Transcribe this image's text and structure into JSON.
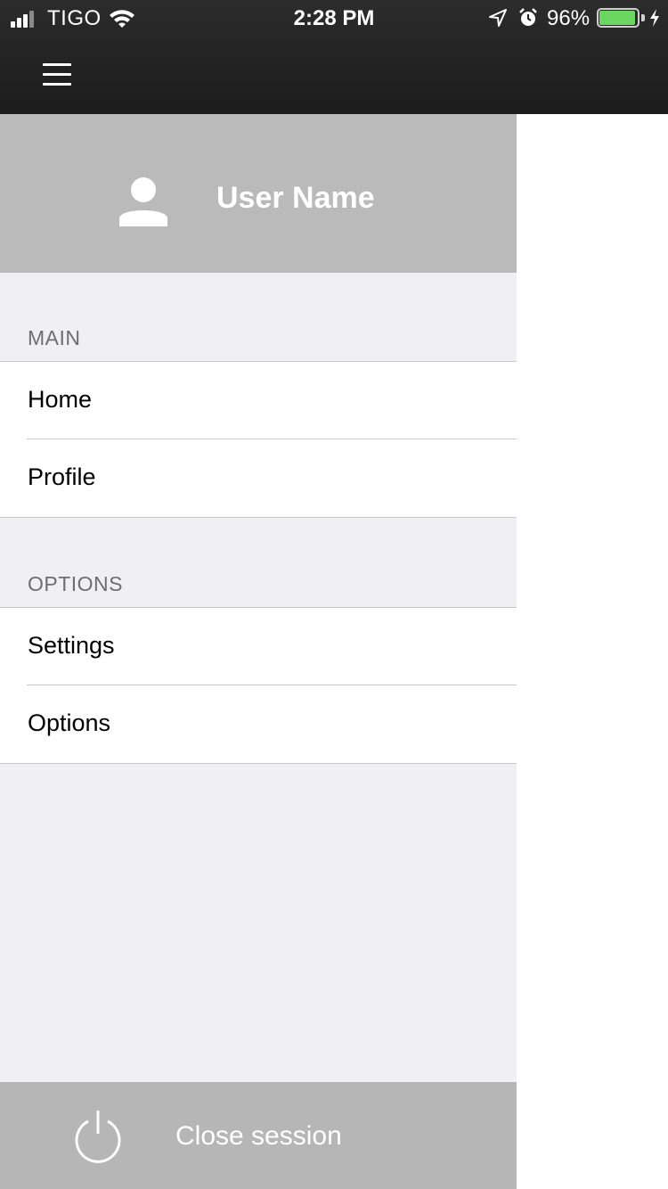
{
  "status_bar": {
    "carrier": "TIGO",
    "time": "2:28 PM",
    "battery_percent": "96%",
    "battery_level": 0.96,
    "battery_color": "#6bd660",
    "icons": [
      "signal-icon",
      "wifi-icon",
      "location-arrow-icon",
      "alarm-icon",
      "battery-icon",
      "charging-bolt-icon"
    ]
  },
  "nav": {
    "menu_icon": "hamburger-menu-icon"
  },
  "drawer": {
    "header": {
      "avatar_icon": "user-avatar-icon",
      "user_name": "User Name"
    },
    "sections": [
      {
        "title": "MAIN",
        "items": [
          {
            "label": "Home"
          },
          {
            "label": "Profile"
          }
        ]
      },
      {
        "title": "OPTIONS",
        "items": [
          {
            "label": "Settings"
          },
          {
            "label": "Options"
          }
        ]
      }
    ],
    "footer": {
      "icon": "power-icon",
      "label": "Close session"
    }
  },
  "colors": {
    "topbar": "#222222",
    "drawer_header": "#bababa",
    "drawer_background": "#efeff4",
    "footer": "#b6b6b6"
  }
}
